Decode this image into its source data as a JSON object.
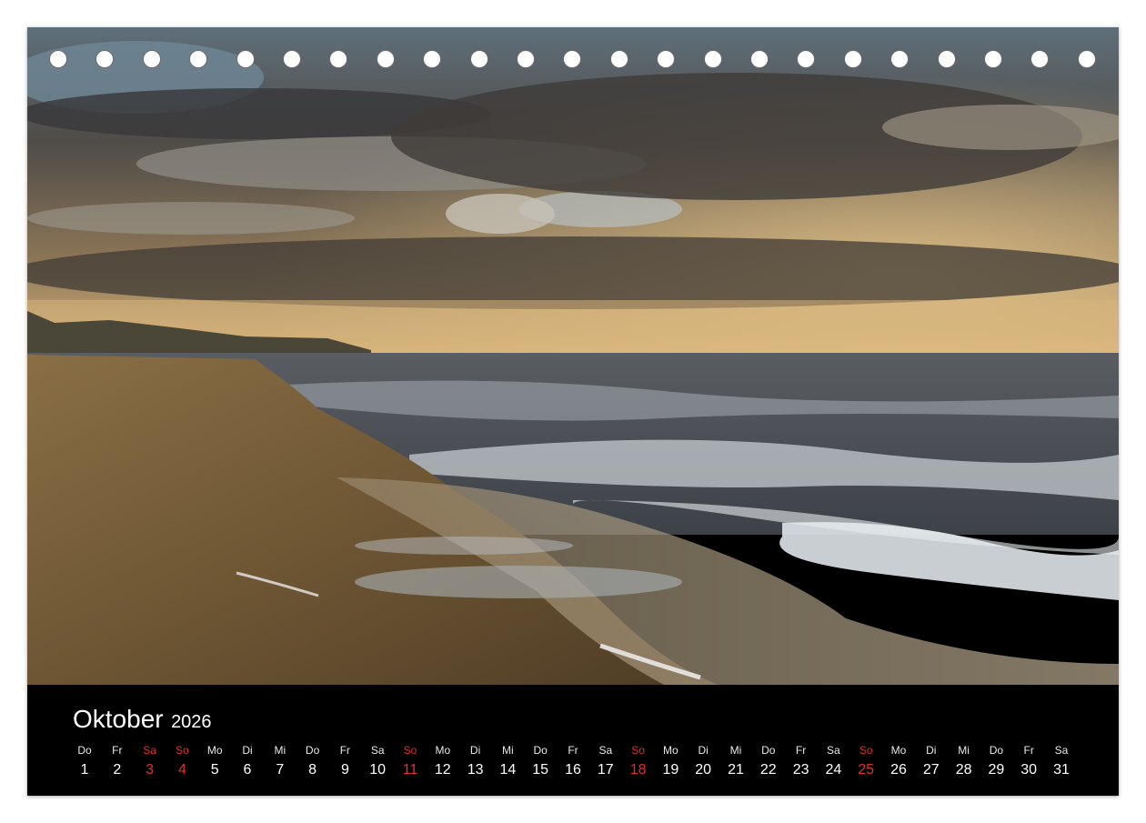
{
  "calendar": {
    "month": "Oktober",
    "year": "2026",
    "days": [
      {
        "wd": "Do",
        "num": "1",
        "red": false
      },
      {
        "wd": "Fr",
        "num": "2",
        "red": false
      },
      {
        "wd": "Sa",
        "num": "3",
        "red": true
      },
      {
        "wd": "So",
        "num": "4",
        "red": true
      },
      {
        "wd": "Mo",
        "num": "5",
        "red": false
      },
      {
        "wd": "Di",
        "num": "6",
        "red": false
      },
      {
        "wd": "Mi",
        "num": "7",
        "red": false
      },
      {
        "wd": "Do",
        "num": "8",
        "red": false
      },
      {
        "wd": "Fr",
        "num": "9",
        "red": false
      },
      {
        "wd": "Sa",
        "num": "10",
        "red": false
      },
      {
        "wd": "So",
        "num": "11",
        "red": true
      },
      {
        "wd": "Mo",
        "num": "12",
        "red": false
      },
      {
        "wd": "Di",
        "num": "13",
        "red": false
      },
      {
        "wd": "Mi",
        "num": "14",
        "red": false
      },
      {
        "wd": "Do",
        "num": "15",
        "red": false
      },
      {
        "wd": "Fr",
        "num": "16",
        "red": false
      },
      {
        "wd": "Sa",
        "num": "17",
        "red": false
      },
      {
        "wd": "So",
        "num": "18",
        "red": true
      },
      {
        "wd": "Mo",
        "num": "19",
        "red": false
      },
      {
        "wd": "Di",
        "num": "20",
        "red": false
      },
      {
        "wd": "Mi",
        "num": "21",
        "red": false
      },
      {
        "wd": "Do",
        "num": "22",
        "red": false
      },
      {
        "wd": "Fr",
        "num": "23",
        "red": false
      },
      {
        "wd": "Sa",
        "num": "24",
        "red": false
      },
      {
        "wd": "So",
        "num": "25",
        "red": true
      },
      {
        "wd": "Mo",
        "num": "26",
        "red": false
      },
      {
        "wd": "Di",
        "num": "27",
        "red": false
      },
      {
        "wd": "Mi",
        "num": "28",
        "red": false
      },
      {
        "wd": "Do",
        "num": "29",
        "red": false
      },
      {
        "wd": "Fr",
        "num": "30",
        "red": false
      },
      {
        "wd": "Sa",
        "num": "31",
        "red": false
      }
    ]
  },
  "colors": {
    "holiday_red": "#e0302a",
    "band_black": "#000000"
  }
}
